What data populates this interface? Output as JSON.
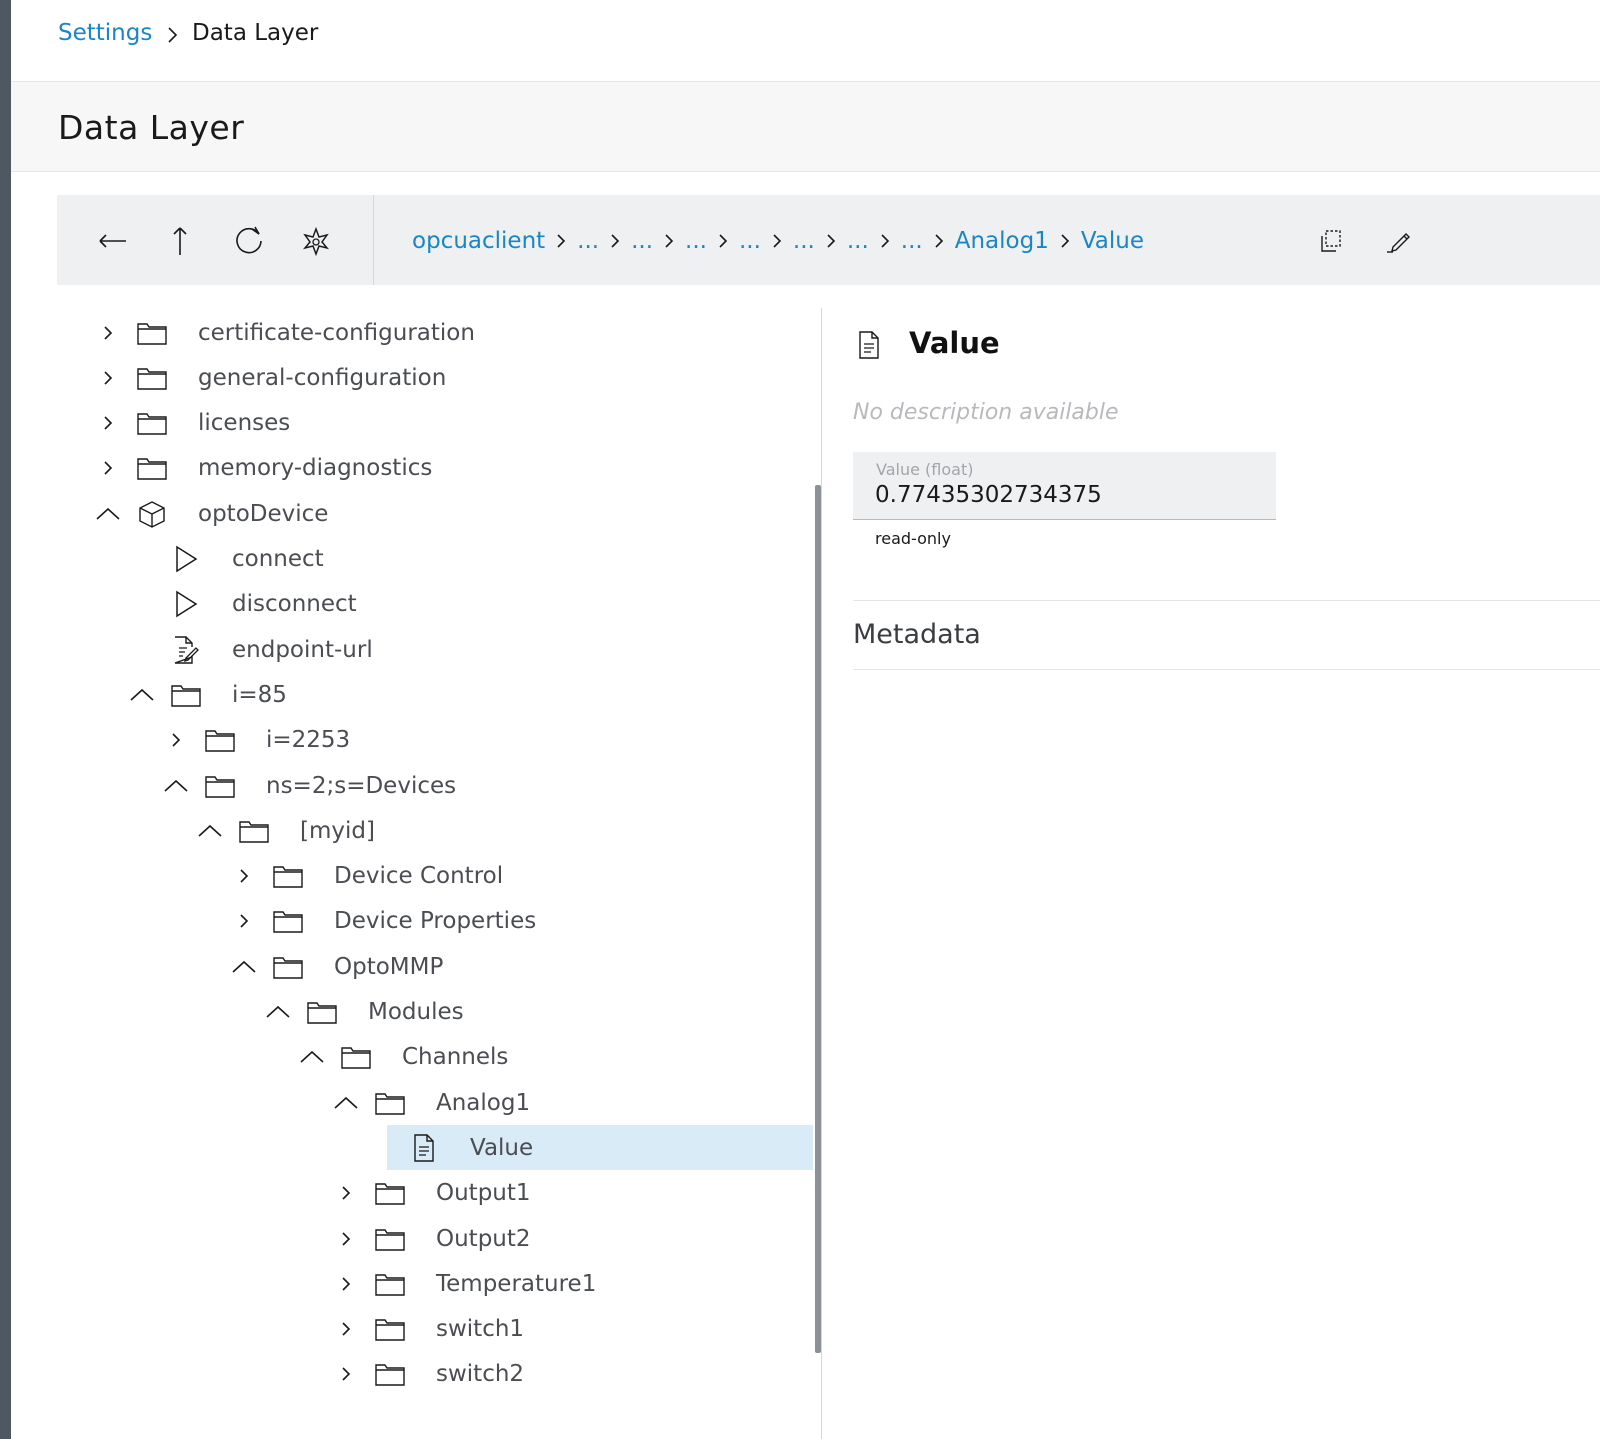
{
  "breadcrumb": {
    "parent": "Settings",
    "current": "Data Layer"
  },
  "page_title": "Data Layer",
  "toolbar": {
    "buttons": [
      "back-arrow-icon",
      "up-arrow-icon",
      "refresh-icon",
      "favorite-icon",
      "copy-icon",
      "edit-icon"
    ],
    "path": [
      "opcuaclient",
      "...",
      "...",
      "...",
      "...",
      "...",
      "...",
      "...",
      "Analog1",
      "Value"
    ]
  },
  "tree": [
    {
      "label": "certificate-configuration",
      "level": 0,
      "state": "collapsed",
      "icon": "folder-icon"
    },
    {
      "label": "general-configuration",
      "level": 0,
      "state": "collapsed",
      "icon": "folder-icon"
    },
    {
      "label": "licenses",
      "level": 0,
      "state": "collapsed",
      "icon": "folder-icon"
    },
    {
      "label": "memory-diagnostics",
      "level": 0,
      "state": "collapsed",
      "icon": "folder-icon"
    },
    {
      "label": "optoDevice",
      "level": 0,
      "state": "expanded",
      "icon": "cube-icon"
    },
    {
      "label": "connect",
      "level": 1,
      "state": "leaf",
      "icon": "play-icon"
    },
    {
      "label": "disconnect",
      "level": 1,
      "state": "leaf",
      "icon": "play-icon"
    },
    {
      "label": "endpoint-url",
      "level": 1,
      "state": "leaf",
      "icon": "document-edit-icon"
    },
    {
      "label": "i=85",
      "level": 1,
      "state": "expanded",
      "icon": "folder-icon"
    },
    {
      "label": "i=2253",
      "level": 2,
      "state": "collapsed",
      "icon": "folder-icon"
    },
    {
      "label": "ns=2;s=Devices",
      "level": 2,
      "state": "expanded",
      "icon": "folder-icon"
    },
    {
      "label": "[myid]",
      "level": 3,
      "state": "expanded",
      "icon": "folder-icon"
    },
    {
      "label": "Device Control",
      "level": 4,
      "state": "collapsed",
      "icon": "folder-icon"
    },
    {
      "label": "Device Properties",
      "level": 4,
      "state": "collapsed",
      "icon": "folder-icon"
    },
    {
      "label": "OptoMMP",
      "level": 4,
      "state": "expanded",
      "icon": "folder-icon"
    },
    {
      "label": "Modules",
      "level": 5,
      "state": "expanded",
      "icon": "folder-icon"
    },
    {
      "label": "Channels",
      "level": 6,
      "state": "expanded",
      "icon": "folder-icon"
    },
    {
      "label": "Analog1",
      "level": 7,
      "state": "expanded",
      "icon": "folder-icon"
    },
    {
      "label": "Value",
      "level": 8,
      "state": "leaf",
      "icon": "document-icon",
      "selected": true
    },
    {
      "label": "Output1",
      "level": 7,
      "state": "collapsed",
      "icon": "folder-icon"
    },
    {
      "label": "Output2",
      "level": 7,
      "state": "collapsed",
      "icon": "folder-icon"
    },
    {
      "label": "Temperature1",
      "level": 7,
      "state": "collapsed",
      "icon": "folder-icon"
    },
    {
      "label": "switch1",
      "level": 7,
      "state": "collapsed",
      "icon": "folder-icon"
    },
    {
      "label": "switch2",
      "level": 7,
      "state": "collapsed",
      "icon": "folder-icon"
    }
  ],
  "detail": {
    "title": "Value",
    "description": "No description available",
    "value_label": "Value (float)",
    "value": "0.77435302734375",
    "access": "read-only",
    "metadata_heading": "Metadata"
  },
  "colors": {
    "accent": "#1a86c6",
    "selected_row": "#d9ebf6",
    "toolbar_bg": "#eff0f1"
  }
}
